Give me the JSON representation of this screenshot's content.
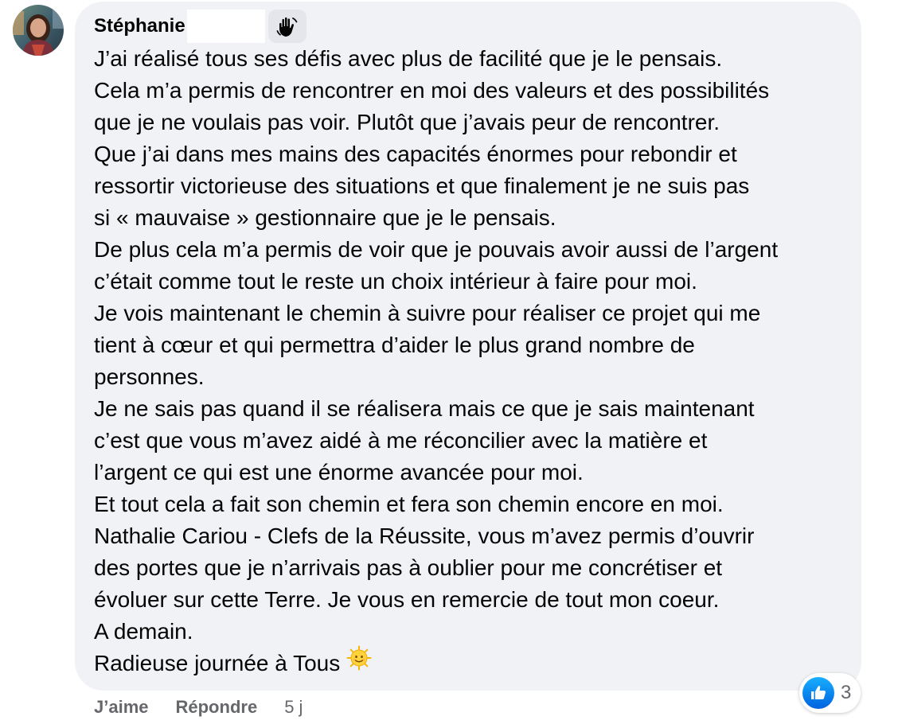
{
  "comment": {
    "author_name": "Stéphanie",
    "badge_icon": "waving-hand-icon",
    "avatar_icon": "profile-photo",
    "lines": [
      "J’ai réalisé tous ses défis avec plus de facilité que je le pensais.",
      "Cela m’a permis de rencontrer en moi des valeurs et des possibilités",
      "que je ne voulais pas voir. Plutôt que j’avais peur de rencontrer.",
      "Que j’ai dans mes mains des capacités énormes pour rebondir et",
      "ressortir victorieuse des situations et que finalement je ne suis pas",
      "si « mauvaise » gestionnaire que je le pensais.",
      "De plus cela m’a permis de voir que je pouvais avoir aussi de l’argent",
      "c’était comme tout le reste un choix intérieur à faire pour moi.",
      "Je vois maintenant le chemin à suivre pour réaliser ce projet qui me",
      "tient à cœur et qui permettra d’aider le plus grand nombre de",
      "personnes.",
      "Je ne sais pas quand il se réalisera mais ce que je sais maintenant",
      "c’est que vous m’avez aidé à me réconcilier avec la matière et",
      "l’argent ce qui est une énorme avancée pour moi.",
      "Et tout cela a fait son chemin et fera son chemin encore en moi.",
      "Nathalie Cariou - Clefs de la Réussite, vous m’avez permis d’ouvrir",
      "des portes que je n’arrivais pas à oublier pour me concrétiser et",
      "évoluer sur cette Terre. Je vous en remercie de tout mon coeur.",
      "A demain.",
      "Radieuse journée à Tous"
    ],
    "trailing_emoji": "sun-with-face-icon"
  },
  "reactions": {
    "icon": "like-thumb-icon",
    "count": "3"
  },
  "actions": {
    "like_label": "J’aime",
    "reply_label": "Répondre",
    "timestamp": "5 j"
  },
  "colors": {
    "bubble": "#f0f2f5",
    "text": "#050505",
    "secondary_text": "#65676b",
    "like_blue": "#0866ff"
  }
}
